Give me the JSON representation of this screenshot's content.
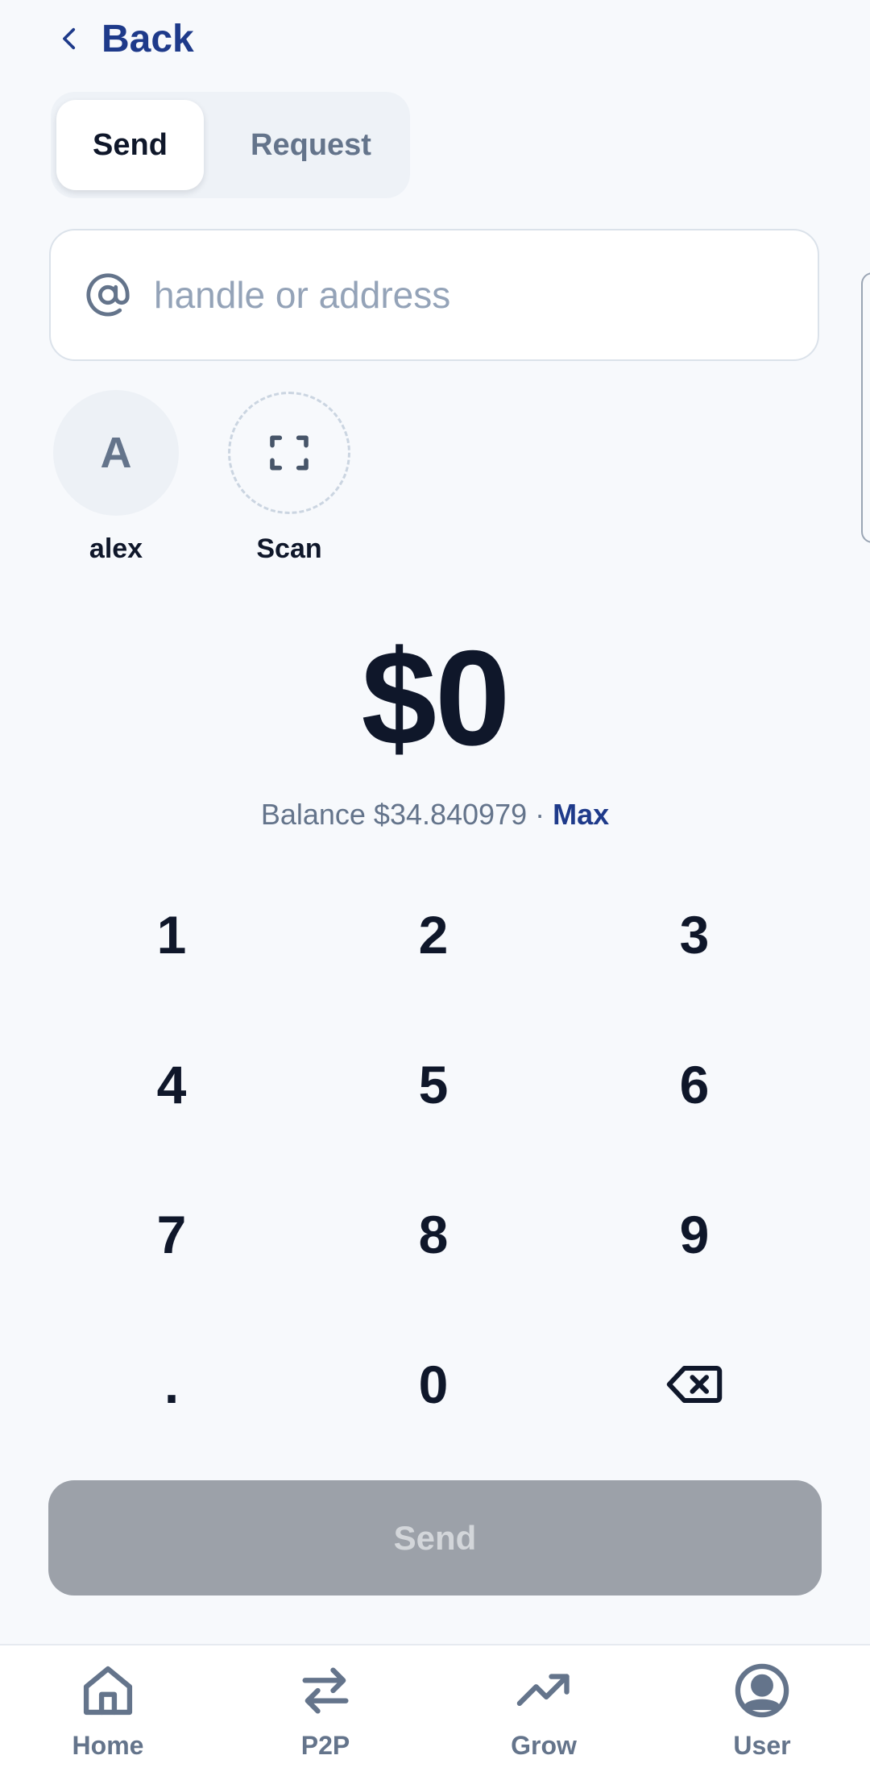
{
  "header": {
    "back_label": "Back",
    "back_icon": "chevron-left-icon"
  },
  "tabs": {
    "send_label": "Send",
    "request_label": "Request",
    "selected": "Send"
  },
  "recipient": {
    "placeholder": "handle or address",
    "value": "",
    "icon": "at-sign-icon"
  },
  "contacts": [
    {
      "initial": "A",
      "label": "alex"
    },
    {
      "label": "Scan",
      "icon": "scan-icon"
    }
  ],
  "amount": {
    "display": "$0"
  },
  "balance": {
    "text": "Balance $34.840979 · ",
    "max_label": "Max"
  },
  "keypad": [
    "1",
    "2",
    "3",
    "4",
    "5",
    "6",
    "7",
    "8",
    "9",
    ".",
    "0"
  ],
  "keypad_delete_icon": "backspace-icon",
  "send_button": {
    "label": "Send",
    "state": "disabled"
  },
  "bottom_nav": {
    "items": [
      {
        "label": "Home",
        "icon": "home-icon"
      },
      {
        "label": "P2P",
        "icon": "arrows-exchange-icon"
      },
      {
        "label": "Grow",
        "icon": "trending-up-icon"
      },
      {
        "label": "User",
        "icon": "user-circle-icon"
      }
    ]
  },
  "colors": {
    "background": "#f7f9fc",
    "accent": "#1e3a8a",
    "text_primary": "#0f172a",
    "text_secondary": "#64748b",
    "button_disabled": "#9ca1a9"
  }
}
